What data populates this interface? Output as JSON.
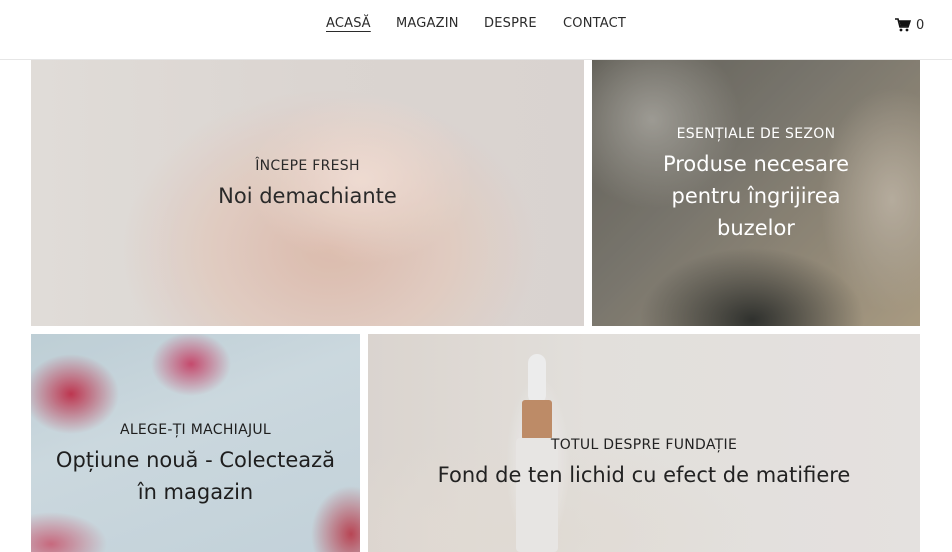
{
  "nav": {
    "items": [
      {
        "label": "ACASĂ",
        "active": true
      },
      {
        "label": "MAGAZIN",
        "active": false
      },
      {
        "label": "DESPRE",
        "active": false
      },
      {
        "label": "CONTACT",
        "active": false
      }
    ]
  },
  "cart": {
    "icon": "shopping-cart-icon",
    "count": "0"
  },
  "tiles": [
    {
      "eyebrow": "ÎNCEPE FRESH",
      "title": "Noi demachiante"
    },
    {
      "eyebrow": "ESENȚIALE DE SEZON",
      "title": "Produse necesare pentru îngrijirea buzelor"
    },
    {
      "eyebrow": "ALEGE-ȚI MACHIAJUL",
      "title": "Opțiune nouă - Colectează în magazin"
    },
    {
      "eyebrow": "TOTUL DESPRE FUNDAȚIE",
      "title": "Fond de ten lichid cu efect de matifiere"
    }
  ],
  "colors": {
    "text": "#2b2b2b",
    "accent": "#111111"
  }
}
